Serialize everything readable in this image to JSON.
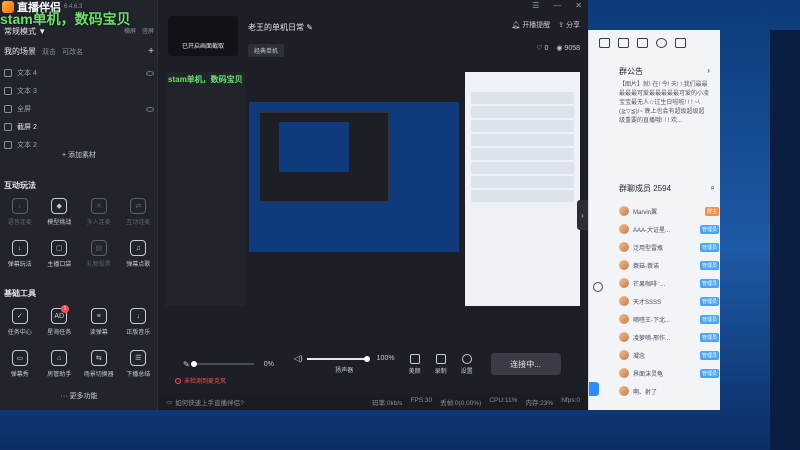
{
  "app": {
    "name": "直播伴侣",
    "version": "6.4.6.3",
    "overlay_text": "stam单机，数码宝贝"
  },
  "left": {
    "mode_label": "常规模式 ▼",
    "orientation": [
      "横屏",
      "竖屏"
    ],
    "scene_tabs": {
      "main": "我的场景",
      "tabs": [
        "双击",
        "可改名"
      ],
      "add": "+"
    },
    "sources": [
      {
        "label": "文本 4",
        "icon": "text-icon"
      },
      {
        "label": "文本 3",
        "icon": "text-icon"
      },
      {
        "label": "全屏",
        "icon": "screen-icon"
      },
      {
        "label": "截屏 2",
        "icon": "screen-icon"
      },
      {
        "label": "文本 2",
        "icon": "text-icon"
      }
    ],
    "add_material": "+ 添加素材",
    "interactive_title": "互动玩法",
    "interactive": [
      {
        "label": "语音连麦",
        "enabled": false
      },
      {
        "label": "模型挑战",
        "enabled": true
      },
      {
        "label": "多人连麦",
        "enabled": false
      },
      {
        "label": "互动连麦",
        "enabled": false
      },
      {
        "label": "弹幕玩法",
        "enabled": true
      },
      {
        "label": "主播口袋",
        "enabled": true
      },
      {
        "label": "礼物投票",
        "enabled": false
      },
      {
        "label": "弹幕点歌",
        "enabled": true
      }
    ],
    "tools_title": "基础工具",
    "tools": [
      {
        "label": "任务中心",
        "badge": ""
      },
      {
        "label": "星海任务",
        "badge": "1"
      },
      {
        "label": "读弹幕",
        "badge": ""
      },
      {
        "label": "正版音乐",
        "badge": ""
      },
      {
        "label": "弹幕秀",
        "badge": ""
      },
      {
        "label": "房管助手",
        "badge": ""
      },
      {
        "label": "场景切换器",
        "badge": ""
      },
      {
        "label": "下播总结",
        "badge": ""
      }
    ],
    "more_features": "··· 更多功能"
  },
  "top": {
    "cover_label": "已开启画面截取",
    "room_title": "老王的单机日常",
    "category": "经典单机",
    "actions": [
      "开播提醒",
      "分享"
    ],
    "likes": "0",
    "viewers": "9058"
  },
  "controls": {
    "mic_pct": "0%",
    "mic_level": 0,
    "speaker_pct": "100%",
    "speaker_level": 1,
    "speaker_label": "扬声器",
    "beauty_label": "美颜",
    "record_label": "录制",
    "settings_label": "设置",
    "connect_label": "连接中...",
    "warning": "未检测到麦克风"
  },
  "status": {
    "help": "如何快速上手直播伴侣?",
    "bitrate": "码率:0kb/s",
    "fps": "FPS:30",
    "dropped": "丢帧:0(0.00%)",
    "cpu": "CPU:11%",
    "mem": "内存:23%",
    "net": "Nfps:0"
  },
  "chat": {
    "notice_title": "群公告",
    "notice_body": "【图片】就! 在! 今! 天! ! 我们最最最最最可爱最最最最最可爱的小凌宝宝最无人☆过生日啦啦! ! ! ~\\(≧▽≦)/~ 晚上也会有超级超级超级重要的直播哦! ! ! 欢...",
    "members_title": "群聊成员 2594",
    "members": [
      {
        "name": "Marvin翼",
        "role": "群主",
        "owner": true
      },
      {
        "name": "AAA-大证星...",
        "role": "管理员",
        "owner": false
      },
      {
        "name": "泛用型雷瓶",
        "role": "管理员",
        "owner": false
      },
      {
        "name": "蓑菇-蓑诺",
        "role": "管理员",
        "owner": false
      },
      {
        "name": "芒果咖啡⁻...",
        "role": "管理员",
        "owner": false
      },
      {
        "name": "天才SSSS",
        "role": "管理员",
        "owner": false
      },
      {
        "name": "嘀嗒王-下北...",
        "role": "管理员",
        "owner": false
      },
      {
        "name": "凌萝嘀-邢作...",
        "role": "管理员",
        "owner": false
      },
      {
        "name": "凝念",
        "role": "管理员",
        "owner": false
      },
      {
        "name": "界面沫灵龟",
        "role": "管理员",
        "owner": false
      },
      {
        "name": "啊、射了",
        "role": "",
        "owner": false
      }
    ]
  }
}
